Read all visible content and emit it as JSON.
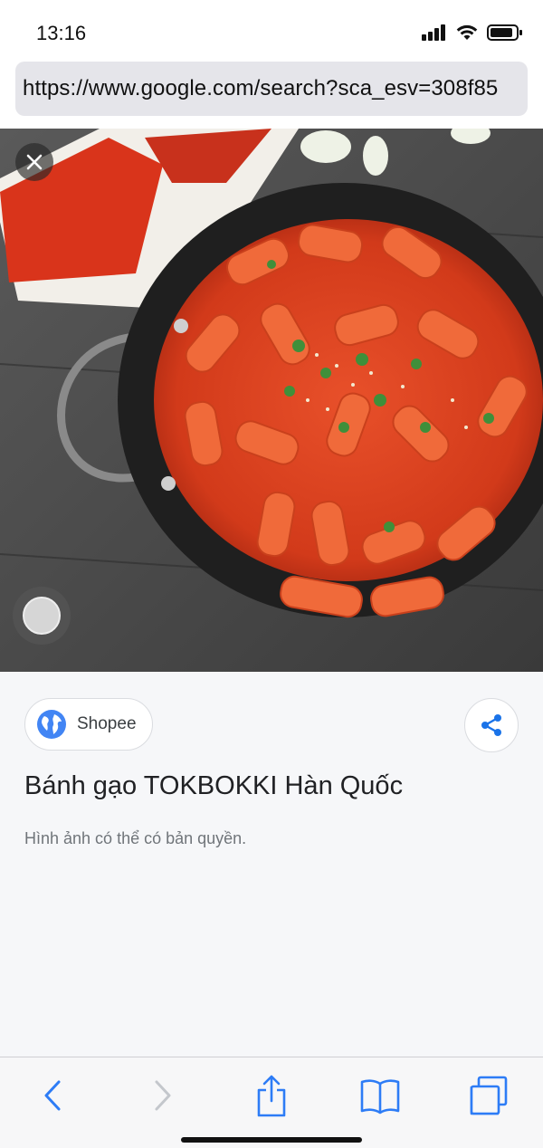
{
  "status_bar": {
    "time": "13:16"
  },
  "browser": {
    "url": "https://www.google.com/search?sca_esv=308f85"
  },
  "image_viewer": {
    "source": {
      "name": "Shopee"
    },
    "title": "Bánh gạo TOKBOKKI Hàn Quốc",
    "copyright_note": "Hình ảnh có thể có bản quyền."
  },
  "colors": {
    "accent": "#1a73e8",
    "ios_blue": "#2d7cf6"
  },
  "icons": {
    "close": "close-icon",
    "share": "share-icon",
    "source": "globe-icon",
    "back": "chevron-left-icon",
    "forward": "chevron-right-icon",
    "browser_share": "share-up-icon",
    "bookmarks": "book-icon",
    "tabs": "tabs-icon"
  }
}
